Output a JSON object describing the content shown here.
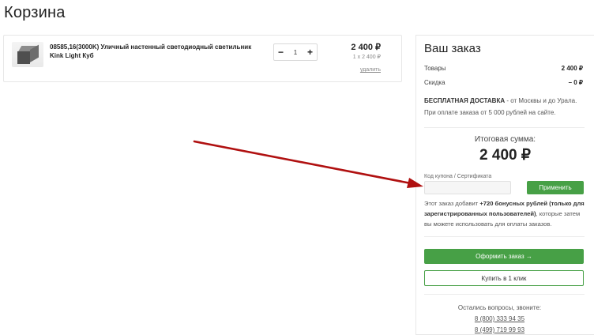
{
  "page": {
    "title": "Корзина"
  },
  "cart": {
    "items": [
      {
        "name": "08585,16(3000K) Уличный настенный светодиодный светильник Kink Light Куб",
        "quantity": "1",
        "price": "2 400 ₽",
        "unit_price": "1 x 2 400 ₽",
        "remove_label": "удалить"
      }
    ],
    "minus_label": "−",
    "plus_label": "+"
  },
  "order": {
    "title": "Ваш заказ",
    "goods_label": "Товары",
    "goods_value": "2 400 ₽",
    "discount_label": "Скидка",
    "discount_value": "– 0 ₽",
    "delivery_bold": "БЕСПЛАТНАЯ ДОСТАВКА",
    "delivery_text": " - от Москвы и до Урала.",
    "delivery_text2": "При оплате заказа от 5 000 рублей на сайте.",
    "total_label": "Итоговая сумма:",
    "total_value": "2 400 ₽",
    "coupon_label": "Код купона / Сертификата",
    "coupon_value": "",
    "apply_label": "Применить",
    "bonus_prefix": "Этот заказ добавит ",
    "bonus_bold": "+720 бонусных рублей (только для зарегистрированных пользователей)",
    "bonus_suffix": ", которые затем вы можете использовать для оплаты заказов.",
    "checkout_label": "Оформить заказ →",
    "one_click_label": "Купить в 1 клик",
    "questions_label": "Остались вопросы, звоните:",
    "phone1": "8 (800) 333 94 35",
    "phone2": "8 (499) 719 99 93"
  },
  "colors": {
    "accent": "#47a046",
    "arrow": "#b01010"
  }
}
